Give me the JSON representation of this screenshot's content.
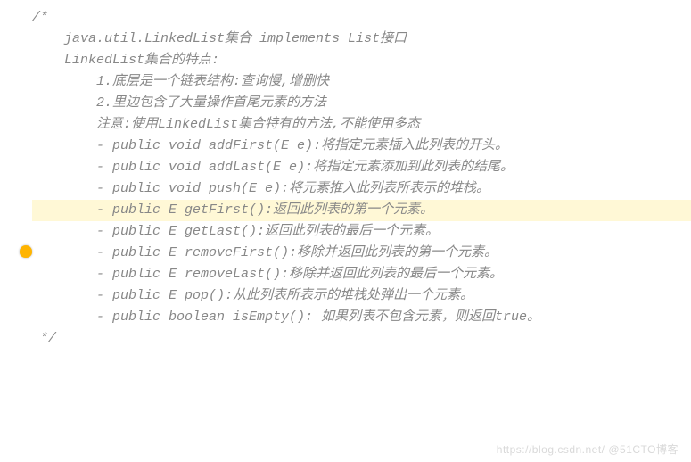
{
  "comment_open": "/*",
  "l1": "    java.util.LinkedList集合 implements List接口",
  "l2": "    LinkedList集合的特点:",
  "l3": "        1.底层是一个链表结构:查询慢,增删快",
  "l4": "        2.里边包含了大量操作首尾元素的方法",
  "l5": "        注意:使用LinkedList集合特有的方法,不能使用多态",
  "blank": "",
  "m1": "        - public void addFirst(E e):将指定元素插入此列表的开头。",
  "m2": "        - public void addLast(E e):将指定元素添加到此列表的结尾。",
  "m3": "        - public void push(E e):将元素推入此列表所表示的堆栈。",
  "m4": "        - public E getFirst():返回此列表的第一个元素。",
  "m5": "        - public E getLast():返回此列表的最后一个元素。",
  "m6": "        - public E removeFirst():移除并返回此列表的第一个元素。",
  "m7": "        - public E removeLast():移除并返回此列表的最后一个元素。",
  "m8": "        - public E pop():从此列表所表示的堆栈处弹出一个元素。",
  "m9": "        - public boolean isEmpty(): 如果列表不包含元素，则返回true。",
  "comment_close": " */",
  "watermark": "https://blog.csdn.net/  @51CTO博客"
}
